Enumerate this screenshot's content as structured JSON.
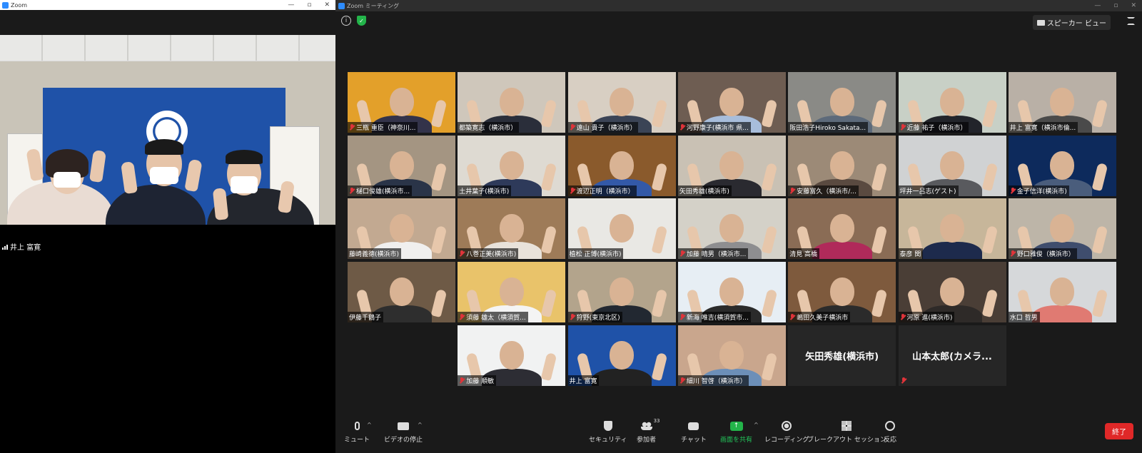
{
  "left_window": {
    "title": "Zoom",
    "speaker_name": "井上 富寛",
    "controls": [
      "—",
      "▫",
      "✕"
    ]
  },
  "right_window": {
    "title": "Zoom ミーティング",
    "speaker_view_label": "スピーカー ビュー",
    "controls": [
      "—",
      "▫",
      "✕"
    ]
  },
  "participants": [
    {
      "name": "三瓶 重臣（神奈川...",
      "muted": true,
      "bg": "#e3a02a",
      "body": "#33334a"
    },
    {
      "name": "都築寛志（横浜市）",
      "muted": false,
      "bg": "#cfc7bb",
      "body": "#2a2e3a"
    },
    {
      "name": "遠山 貴子（横浜市）",
      "muted": true,
      "bg": "#d8cfc3",
      "body": "#3b4456"
    },
    {
      "name": "河野康子(横浜市 県...",
      "muted": true,
      "bg": "#6e5d52",
      "body": "#a7bddb"
    },
    {
      "name": "阪田浩子Hiroko Sakata...",
      "muted": false,
      "bg": "#8a8a86",
      "body": "#5d6a7a"
    },
    {
      "name": "近藤 祐子（横浜市）",
      "muted": true,
      "bg": "#c8d0c6",
      "body": "#22242a"
    },
    {
      "name": "井上 富寛（横浜市倫...",
      "muted": false,
      "bg": "#b9b0a6",
      "body": "#4a4a4a"
    },
    {
      "name": "樋口俊雄(横浜市...",
      "muted": true,
      "bg": "#a49582",
      "body": "#2a3448"
    },
    {
      "name": "土井葉子(横浜市)",
      "muted": false,
      "bg": "#dedad2",
      "body": "#2e3a5a"
    },
    {
      "name": "渡辺正明（横浜市）",
      "muted": true,
      "bg": "#8a5a2c",
      "body": "#3359a8"
    },
    {
      "name": "矢田秀雄(横浜市)",
      "muted": false,
      "bg": "#c9c1b4",
      "body": "#2a2a30"
    },
    {
      "name": "安藤富久（横浜市/...",
      "muted": true,
      "bg": "#9c8a77",
      "body": "#5a4a40"
    },
    {
      "name": "坪井一吕志(ゲスト)",
      "muted": false,
      "bg": "#d0d2d3",
      "body": "#595a5e"
    },
    {
      "name": "金子信洋(横浜市)",
      "muted": true,
      "bg": "#0d2a5c",
      "body": "#4a5d7c"
    },
    {
      "name": "藤崎義德(横浜市)",
      "muted": false,
      "bg": "#c2a991",
      "body": "#f0efee"
    },
    {
      "name": "八巻正美(横浜市)",
      "muted": true,
      "bg": "#9e7b58",
      "body": "#e8e2da"
    },
    {
      "name": "植松 正博(横浜市)",
      "muted": false,
      "bg": "#e9e8e4",
      "body": "#e9e8e4"
    },
    {
      "name": "加藤 晴男（横浜市...",
      "muted": true,
      "bg": "#d4d1c8",
      "body": "#8e8e90"
    },
    {
      "name": "清見 高橋",
      "muted": false,
      "bg": "#8a6c55",
      "body": "#b02a5a"
    },
    {
      "name": "泰彦 関",
      "muted": false,
      "bg": "#c7b69a",
      "body": "#1d2a4c"
    },
    {
      "name": "野口雅俊（横浜市）",
      "muted": true,
      "bg": "#bdb5a8",
      "body": "#3f4d6d"
    },
    {
      "name": "伊藤千鶴子",
      "muted": false,
      "bg": "#6e5a46",
      "body": "#2e2e2e"
    },
    {
      "name": "須藤 雄太（横須賀...",
      "muted": true,
      "bg": "#e9c36a",
      "body": "#f4f4f4"
    },
    {
      "name": "狩野(東京北区)",
      "muted": true,
      "bg": "#b3a48c",
      "body": "#222831"
    },
    {
      "name": "新海 唯吉(横須賀市...",
      "muted": true,
      "bg": "#e7eef4",
      "body": "#2a2a2a"
    },
    {
      "name": "嶋田久美子横浜市",
      "muted": true,
      "bg": "#7e5a3d",
      "body": "#2b2b2b"
    },
    {
      "name": "河原 進(横浜市)",
      "muted": true,
      "bg": "#4a3e36",
      "body": "#2e2a28"
    },
    {
      "name": "水口 哲男",
      "muted": false,
      "bg": "#d6d8da",
      "body": "#e07a72"
    },
    {
      "name": "加藤 順敏",
      "muted": true,
      "bg": "#f1f2f2",
      "body": "#2d2d34"
    },
    {
      "name": "井上 富寛",
      "muted": false,
      "bg": "#1f52a8",
      "body": "#222",
      "active": true
    },
    {
      "name": "細川 智啓（横浜市）",
      "muted": true,
      "bg": "#c9a68d",
      "body": "#6c8fb8"
    },
    {
      "name": "矢田秀雄(横浜市)",
      "muted": false,
      "name_only": true
    },
    {
      "name": "山本太郎(カメラ...",
      "muted": true,
      "name_only": true
    }
  ],
  "toolbar": {
    "mute": "ミュート",
    "video": "ビデオの停止",
    "security": "セキュリティ",
    "participants": "参加者",
    "participants_count": "33",
    "chat": "チャット",
    "share": "画面を共有",
    "record": "レコーディング",
    "breakout": "ブレークアウト セッション",
    "reactions": "反応",
    "end": "終了"
  },
  "colors": {
    "accent_green": "#23b44a",
    "end_red": "#e02828",
    "active_border": "#a8d93a"
  }
}
